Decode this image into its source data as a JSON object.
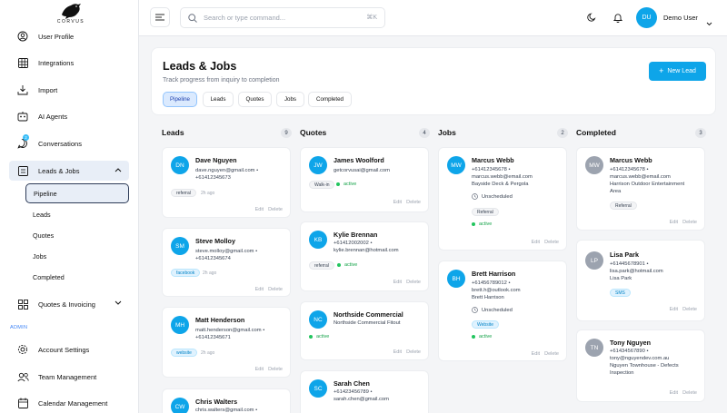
{
  "brand": {
    "logo_text": "CORVUS"
  },
  "sidebar": {
    "items": [
      {
        "label": "User Profile"
      },
      {
        "label": "Integrations"
      },
      {
        "label": "Import"
      },
      {
        "label": "AI Agents"
      },
      {
        "label": "Conversations",
        "badge": "2"
      },
      {
        "label": "Leads & Jobs"
      },
      {
        "label": "Quotes & Invoicing"
      }
    ],
    "sub_items": [
      {
        "label": "Pipeline"
      },
      {
        "label": "Leads"
      },
      {
        "label": "Quotes"
      },
      {
        "label": "Jobs"
      },
      {
        "label": "Completed"
      }
    ],
    "admin_label": "ADMIN",
    "admin_items": [
      {
        "label": "Account Settings"
      },
      {
        "label": "Team Management"
      },
      {
        "label": "Calendar Management"
      }
    ]
  },
  "topbar": {
    "search_placeholder": "Search or type command...",
    "shortcut": "⌘K",
    "user_initials": "DU",
    "user_name": "Demo User"
  },
  "header": {
    "title": "Leads & Jobs",
    "subtitle": "Track progress from inquiry to completion",
    "new_lead_label": "New Lead",
    "tabs": [
      {
        "label": "Pipeline"
      },
      {
        "label": "Leads"
      },
      {
        "label": "Quotes"
      },
      {
        "label": "Jobs"
      },
      {
        "label": "Completed"
      }
    ]
  },
  "actions": {
    "edit": "Edit",
    "delete": "Delete"
  },
  "columns": [
    {
      "title": "Leads",
      "count": "9",
      "cards": [
        {
          "initials": "DN",
          "name": "Dave Nguyen",
          "lines": [
            "dave.nguyen@gmail.com •",
            "+61412345673"
          ],
          "tag": "referral",
          "ago": "2h ago"
        },
        {
          "initials": "SM",
          "name": "Steve Molloy",
          "lines": [
            "steve.molloy@gmail.com •",
            "+61412345674"
          ],
          "tag": "facebook",
          "ago": "2h ago"
        },
        {
          "initials": "MH",
          "name": "Matt Henderson",
          "lines": [
            "matt.henderson@gmail.com •",
            "+61412345671"
          ],
          "tag": "website",
          "ago": "2h ago"
        },
        {
          "initials": "CW",
          "name": "Chris Walters",
          "lines": [
            "chris.walters@gmail.com •"
          ]
        }
      ]
    },
    {
      "title": "Quotes",
      "count": "4",
      "cards": [
        {
          "initials": "JW",
          "name": "James Woolford",
          "lines": [
            "getcorvusai@gmail.com"
          ],
          "tag": "Walk-in",
          "status": "active"
        },
        {
          "initials": "KB",
          "name": "Kylie Brennan",
          "lines": [
            "+61412002002 •",
            "kylie.brennan@hotmail.com"
          ],
          "tag": "referral",
          "status": "active"
        },
        {
          "initials": "NC",
          "name": "Northside Commercial",
          "lines": [
            "Northside Commercial Fitout"
          ],
          "status": "active"
        },
        {
          "initials": "SC",
          "name": "Sarah Chen",
          "lines": [
            "+61423456789 •",
            "sarah.chen@gmail.com"
          ]
        }
      ]
    },
    {
      "title": "Jobs",
      "count": "2",
      "cards": [
        {
          "initials": "MW",
          "name": "Marcus Webb",
          "lines": [
            "+61412345678 •",
            "marcus.webb@email.com",
            "Bayside Deck & Pergola"
          ],
          "schedule": "Unscheduled",
          "tag": "Referral",
          "status": "active"
        },
        {
          "initials": "BH",
          "name": "Brett Harrison",
          "lines": [
            "+61456789012 •",
            "brett.h@outlook.com",
            "Brett Harrison"
          ],
          "schedule": "Unscheduled",
          "tag": "Website",
          "status": "active"
        }
      ]
    },
    {
      "title": "Completed",
      "count": "3",
      "cards": [
        {
          "initials": "MW",
          "name": "Marcus Webb",
          "lines": [
            "+61412345678 •",
            "marcus.webb@email.com",
            "Harrison Outdoor Entertainment",
            "Area"
          ],
          "tag": "Referral"
        },
        {
          "initials": "LP",
          "name": "Lisa Park",
          "lines": [
            "+61445678901 •",
            "lisa.park@hotmail.com",
            "Lisa Park"
          ],
          "tag": "SMS"
        },
        {
          "initials": "TN",
          "name": "Tony Nguyen",
          "lines": [
            "+61434567890 •",
            "tony@nguyendev.com.au",
            "Nguyen Townhouse - Defects",
            "Inspection"
          ]
        }
      ]
    }
  ]
}
